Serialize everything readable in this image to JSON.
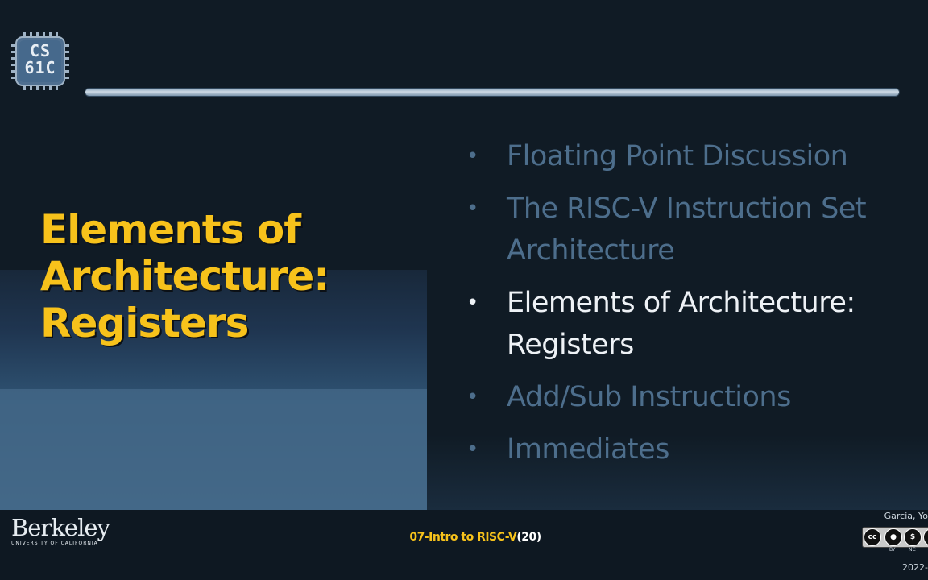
{
  "logo": {
    "line1": "CS",
    "line2": "61C"
  },
  "section_title": {
    "line1": "Elements of",
    "line2": "Architecture:",
    "line3": "Registers"
  },
  "agenda": {
    "bullet": "•",
    "items": [
      {
        "label": "Floating Point Discussion",
        "active": false
      },
      {
        "label": "The RISC-V Instruction Set Architecture",
        "active": false
      },
      {
        "label": "Elements of Architecture: Registers",
        "active": true
      },
      {
        "label": "Add/Sub Instructions",
        "active": false
      },
      {
        "label": "Immediates",
        "active": false
      }
    ]
  },
  "footer": {
    "university": "Berkeley",
    "university_sub": "University of California",
    "lecture": "07-Intro to RISC-V",
    "slide_number": "(20)",
    "author": "Garcia, Yo",
    "license": {
      "cc": "cc",
      "by": "BY",
      "nc": "NC"
    },
    "year": "2022-"
  },
  "colors": {
    "accent": "#f7c21b",
    "background": "#101b25",
    "inactive_item": "#4d6e8c",
    "active_item": "#eef2f6"
  }
}
